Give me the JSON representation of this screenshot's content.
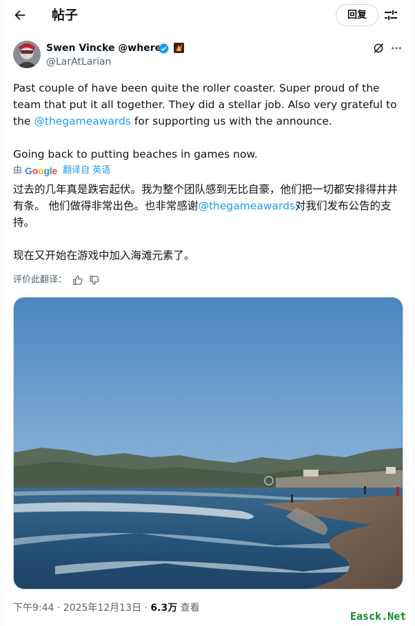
{
  "header": {
    "title": "帖子",
    "reply_label": "回复"
  },
  "author": {
    "name": "Swen Vincke @where?",
    "handle": "@LarAtLarian"
  },
  "tweet": {
    "p1_before": "Past couple of have been quite the roller coaster. Super proud of the team that put it all together. They did a stellar job. Also very grateful to the ",
    "p1_mention": "@thegameawards",
    "p1_after": " for supporting us with the announce.",
    "p2": "Going back to putting beaches in games now."
  },
  "translation": {
    "by_prefix": "由",
    "provider": "Google",
    "link_label": "翻译自 英语",
    "p1_before": "过去的几年真是跌宕起伏。我为整个团队感到无比自豪，他们把一切都安排得井井有条。 他们做得非常出色。也非常感谢",
    "p1_mention": "@thegameawards",
    "p1_after": "对我们发布公告的支持。",
    "p2": "现在又开始在游戏中加入海滩元素了。",
    "rate_label": "评价此翻译："
  },
  "footer": {
    "time": "下午9:44 · 2025年12月13日 · ",
    "views_count": "6.3万",
    "views_label": " 查看"
  },
  "watermark": "Easck.Net",
  "colors": {
    "accent": "#1d9bf0",
    "text": "#0f1419",
    "secondary": "#536471",
    "border": "#cfd9de",
    "verified": "#1d9bf0"
  },
  "icons": [
    "back-arrow-icon",
    "adjust-icon",
    "verified-icon",
    "affiliate-badge-icon",
    "grok-icon",
    "more-icon",
    "thumbs-up-icon",
    "thumbs-down-icon"
  ]
}
